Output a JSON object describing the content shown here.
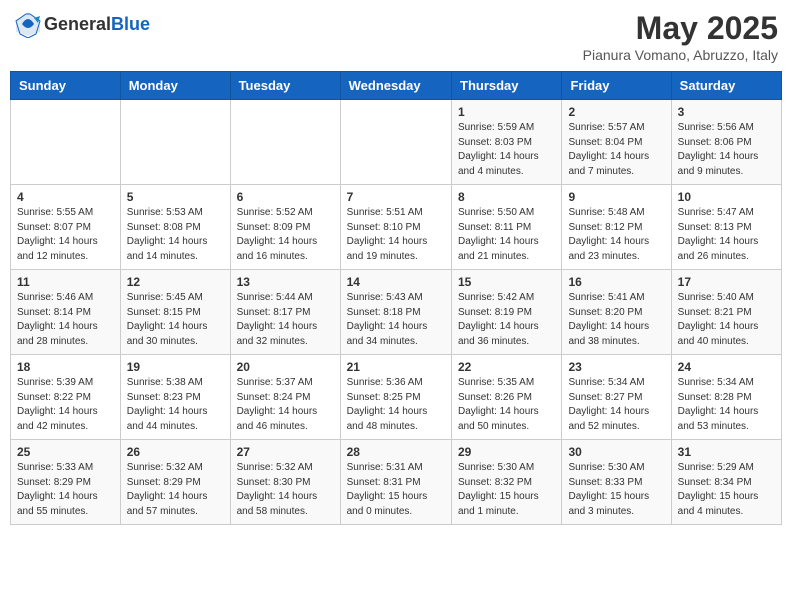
{
  "header": {
    "logo_general": "General",
    "logo_blue": "Blue",
    "month_title": "May 2025",
    "location": "Pianura Vomano, Abruzzo, Italy"
  },
  "weekdays": [
    "Sunday",
    "Monday",
    "Tuesday",
    "Wednesday",
    "Thursday",
    "Friday",
    "Saturday"
  ],
  "weeks": [
    [
      {
        "day": "",
        "info": ""
      },
      {
        "day": "",
        "info": ""
      },
      {
        "day": "",
        "info": ""
      },
      {
        "day": "",
        "info": ""
      },
      {
        "day": "1",
        "info": "Sunrise: 5:59 AM\nSunset: 8:03 PM\nDaylight: 14 hours\nand 4 minutes."
      },
      {
        "day": "2",
        "info": "Sunrise: 5:57 AM\nSunset: 8:04 PM\nDaylight: 14 hours\nand 7 minutes."
      },
      {
        "day": "3",
        "info": "Sunrise: 5:56 AM\nSunset: 8:06 PM\nDaylight: 14 hours\nand 9 minutes."
      }
    ],
    [
      {
        "day": "4",
        "info": "Sunrise: 5:55 AM\nSunset: 8:07 PM\nDaylight: 14 hours\nand 12 minutes."
      },
      {
        "day": "5",
        "info": "Sunrise: 5:53 AM\nSunset: 8:08 PM\nDaylight: 14 hours\nand 14 minutes."
      },
      {
        "day": "6",
        "info": "Sunrise: 5:52 AM\nSunset: 8:09 PM\nDaylight: 14 hours\nand 16 minutes."
      },
      {
        "day": "7",
        "info": "Sunrise: 5:51 AM\nSunset: 8:10 PM\nDaylight: 14 hours\nand 19 minutes."
      },
      {
        "day": "8",
        "info": "Sunrise: 5:50 AM\nSunset: 8:11 PM\nDaylight: 14 hours\nand 21 minutes."
      },
      {
        "day": "9",
        "info": "Sunrise: 5:48 AM\nSunset: 8:12 PM\nDaylight: 14 hours\nand 23 minutes."
      },
      {
        "day": "10",
        "info": "Sunrise: 5:47 AM\nSunset: 8:13 PM\nDaylight: 14 hours\nand 26 minutes."
      }
    ],
    [
      {
        "day": "11",
        "info": "Sunrise: 5:46 AM\nSunset: 8:14 PM\nDaylight: 14 hours\nand 28 minutes."
      },
      {
        "day": "12",
        "info": "Sunrise: 5:45 AM\nSunset: 8:15 PM\nDaylight: 14 hours\nand 30 minutes."
      },
      {
        "day": "13",
        "info": "Sunrise: 5:44 AM\nSunset: 8:17 PM\nDaylight: 14 hours\nand 32 minutes."
      },
      {
        "day": "14",
        "info": "Sunrise: 5:43 AM\nSunset: 8:18 PM\nDaylight: 14 hours\nand 34 minutes."
      },
      {
        "day": "15",
        "info": "Sunrise: 5:42 AM\nSunset: 8:19 PM\nDaylight: 14 hours\nand 36 minutes."
      },
      {
        "day": "16",
        "info": "Sunrise: 5:41 AM\nSunset: 8:20 PM\nDaylight: 14 hours\nand 38 minutes."
      },
      {
        "day": "17",
        "info": "Sunrise: 5:40 AM\nSunset: 8:21 PM\nDaylight: 14 hours\nand 40 minutes."
      }
    ],
    [
      {
        "day": "18",
        "info": "Sunrise: 5:39 AM\nSunset: 8:22 PM\nDaylight: 14 hours\nand 42 minutes."
      },
      {
        "day": "19",
        "info": "Sunrise: 5:38 AM\nSunset: 8:23 PM\nDaylight: 14 hours\nand 44 minutes."
      },
      {
        "day": "20",
        "info": "Sunrise: 5:37 AM\nSunset: 8:24 PM\nDaylight: 14 hours\nand 46 minutes."
      },
      {
        "day": "21",
        "info": "Sunrise: 5:36 AM\nSunset: 8:25 PM\nDaylight: 14 hours\nand 48 minutes."
      },
      {
        "day": "22",
        "info": "Sunrise: 5:35 AM\nSunset: 8:26 PM\nDaylight: 14 hours\nand 50 minutes."
      },
      {
        "day": "23",
        "info": "Sunrise: 5:34 AM\nSunset: 8:27 PM\nDaylight: 14 hours\nand 52 minutes."
      },
      {
        "day": "24",
        "info": "Sunrise: 5:34 AM\nSunset: 8:28 PM\nDaylight: 14 hours\nand 53 minutes."
      }
    ],
    [
      {
        "day": "25",
        "info": "Sunrise: 5:33 AM\nSunset: 8:29 PM\nDaylight: 14 hours\nand 55 minutes."
      },
      {
        "day": "26",
        "info": "Sunrise: 5:32 AM\nSunset: 8:29 PM\nDaylight: 14 hours\nand 57 minutes."
      },
      {
        "day": "27",
        "info": "Sunrise: 5:32 AM\nSunset: 8:30 PM\nDaylight: 14 hours\nand 58 minutes."
      },
      {
        "day": "28",
        "info": "Sunrise: 5:31 AM\nSunset: 8:31 PM\nDaylight: 15 hours\nand 0 minutes."
      },
      {
        "day": "29",
        "info": "Sunrise: 5:30 AM\nSunset: 8:32 PM\nDaylight: 15 hours\nand 1 minute."
      },
      {
        "day": "30",
        "info": "Sunrise: 5:30 AM\nSunset: 8:33 PM\nDaylight: 15 hours\nand 3 minutes."
      },
      {
        "day": "31",
        "info": "Sunrise: 5:29 AM\nSunset: 8:34 PM\nDaylight: 15 hours\nand 4 minutes."
      }
    ]
  ]
}
